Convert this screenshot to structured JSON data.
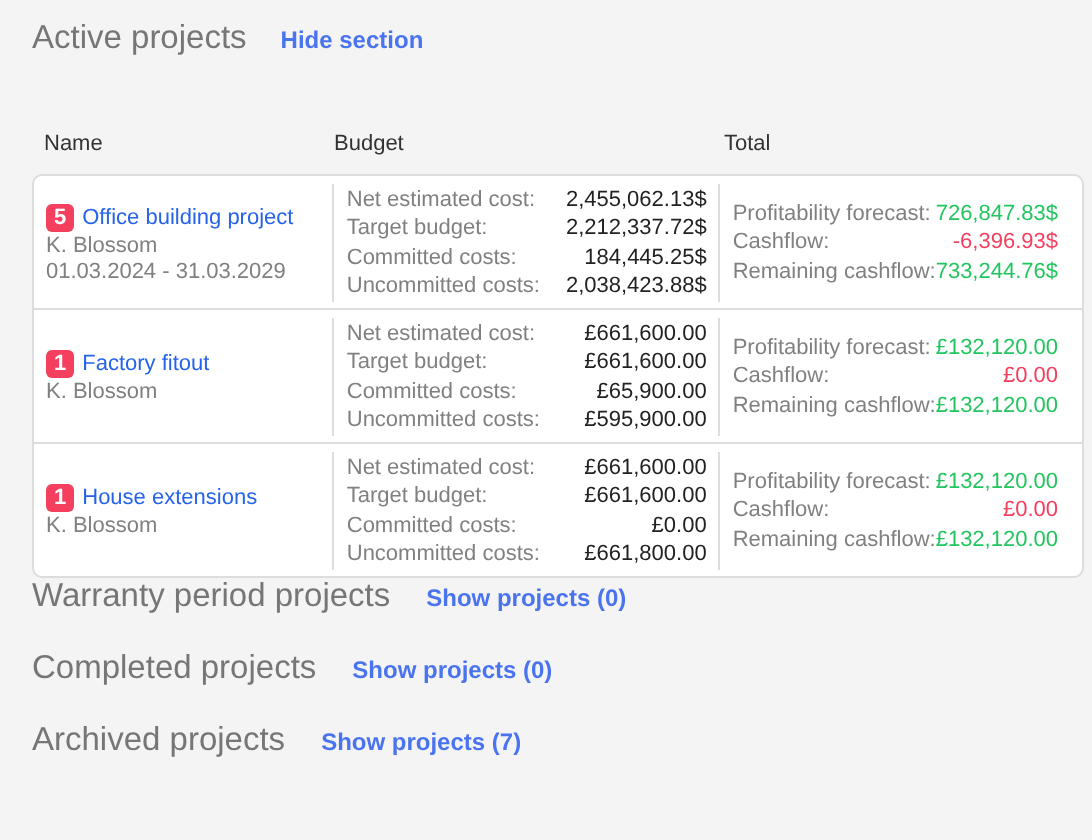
{
  "active": {
    "title": "Active projects",
    "link": "Hide section"
  },
  "columns": [
    "Name",
    "Budget",
    "Total"
  ],
  "projects": [
    {
      "count": "5",
      "name": "Office building project",
      "owner": "K. Blossom",
      "dates": "01.03.2024 - 31.03.2029",
      "budget": [
        {
          "label": "Net estimated cost:",
          "value": "2,455,062.13$"
        },
        {
          "label": "Target budget:",
          "value": "2,212,337.72$"
        },
        {
          "label": "Committed costs:",
          "value": "184,445.25$"
        },
        {
          "label": "Uncommitted costs:",
          "value": "2,038,423.88$"
        }
      ],
      "totals": [
        {
          "label": "Profitability forecast:",
          "value": "726,847.83$",
          "color": "#22c55e"
        },
        {
          "label": "Cashflow:",
          "value": "-6,396.93$",
          "color": "#f43f5e"
        },
        {
          "label": "Remaining cashflow:",
          "value": "733,244.76$",
          "color": "#22c55e"
        }
      ]
    },
    {
      "count": "1",
      "name": "Factory fitout",
      "owner": "K. Blossom",
      "budget": [
        {
          "label": "Net estimated cost:",
          "value": "£661,600.00"
        },
        {
          "label": "Target budget:",
          "value": "£661,600.00"
        },
        {
          "label": "Committed costs:",
          "value": "£65,900.00"
        },
        {
          "label": "Uncommitted costs:",
          "value": "£595,900.00"
        }
      ],
      "totals": [
        {
          "label": "Profitability forecast:",
          "value": "£132,120.00",
          "color": "#22c55e"
        },
        {
          "label": "Cashflow:",
          "value": "£0.00",
          "color": "#f43f5e"
        },
        {
          "label": "Remaining cashflow:",
          "value": "£132,120.00",
          "color": "#22c55e"
        }
      ]
    },
    {
      "count": "1",
      "name": "House extensions",
      "owner": "K. Blossom",
      "budget": [
        {
          "label": "Net estimated cost:",
          "value": "£661,600.00"
        },
        {
          "label": "Target budget:",
          "value": "£661,600.00"
        },
        {
          "label": "Committed costs:",
          "value": "£0.00"
        },
        {
          "label": "Uncommitted costs:",
          "value": "£661,800.00"
        }
      ],
      "totals": [
        {
          "label": "Profitability forecast:",
          "value": "£132,120.00",
          "color": "#22c55e"
        },
        {
          "label": "Cashflow:",
          "value": "£0.00",
          "color": "#f43f5e"
        },
        {
          "label": "Remaining cashflow:",
          "value": "£132,120.00",
          "color": "#22c55e"
        }
      ]
    }
  ],
  "sections": [
    {
      "title": "Warranty period projects",
      "link": "Show projects (0)"
    },
    {
      "title": "Completed projects",
      "link": "Show projects (0)"
    },
    {
      "title": "Archived projects",
      "link": "Show projects (7)"
    }
  ]
}
